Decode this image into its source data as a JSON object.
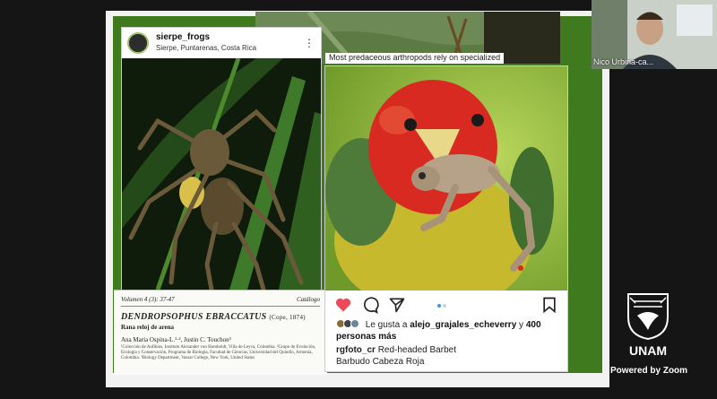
{
  "left_post": {
    "username": "sierpe_frogs",
    "location": "Sierpe, Puntarenas, Costa Rica"
  },
  "article": {
    "volume": "Volumen 4 (3): 37-47",
    "catalog": "Catálogo",
    "species": "Dendropsophus ebraccatus",
    "species_author": "(Cope, 1874)",
    "common_name": "Rana reloj de arena",
    "authors": "Ana María Ospina-L.¹·², Justin C. Touchon³",
    "affiliation": "¹Colección de Anfibios, Instituto Alexander von Humboldt, Villa de Leyva, Colombia. ²Grupo de Evolución, Ecología y Conservación, Programa de Biología, Facultad de Ciencias, Universidad del Quindío, Armenia, Colombia. ³Biology Department, Vassar College, New York, United States"
  },
  "top_strip": {
    "text": "Most predaceous arthropods rely on specialized"
  },
  "right_post": {
    "likes_prefix": "Le gusta a",
    "likes_user": "alejo_grajales_echeverry",
    "likes_middle": "y",
    "likes_count": "400 personas más",
    "caption_user": "rgfoto_cr",
    "caption_text": "Red-headed Barbet",
    "caption_line2": "Barbudo Cabeza Roja"
  },
  "video": {
    "participant_name": "Nico Urbina-ca..."
  },
  "branding": {
    "institution": "UNAM",
    "powered_by": "Powered by Zoom"
  },
  "colors": {
    "slide_green": "#3f7a1e",
    "like_red": "#ed4956",
    "dot_blue": "#3897f0"
  }
}
